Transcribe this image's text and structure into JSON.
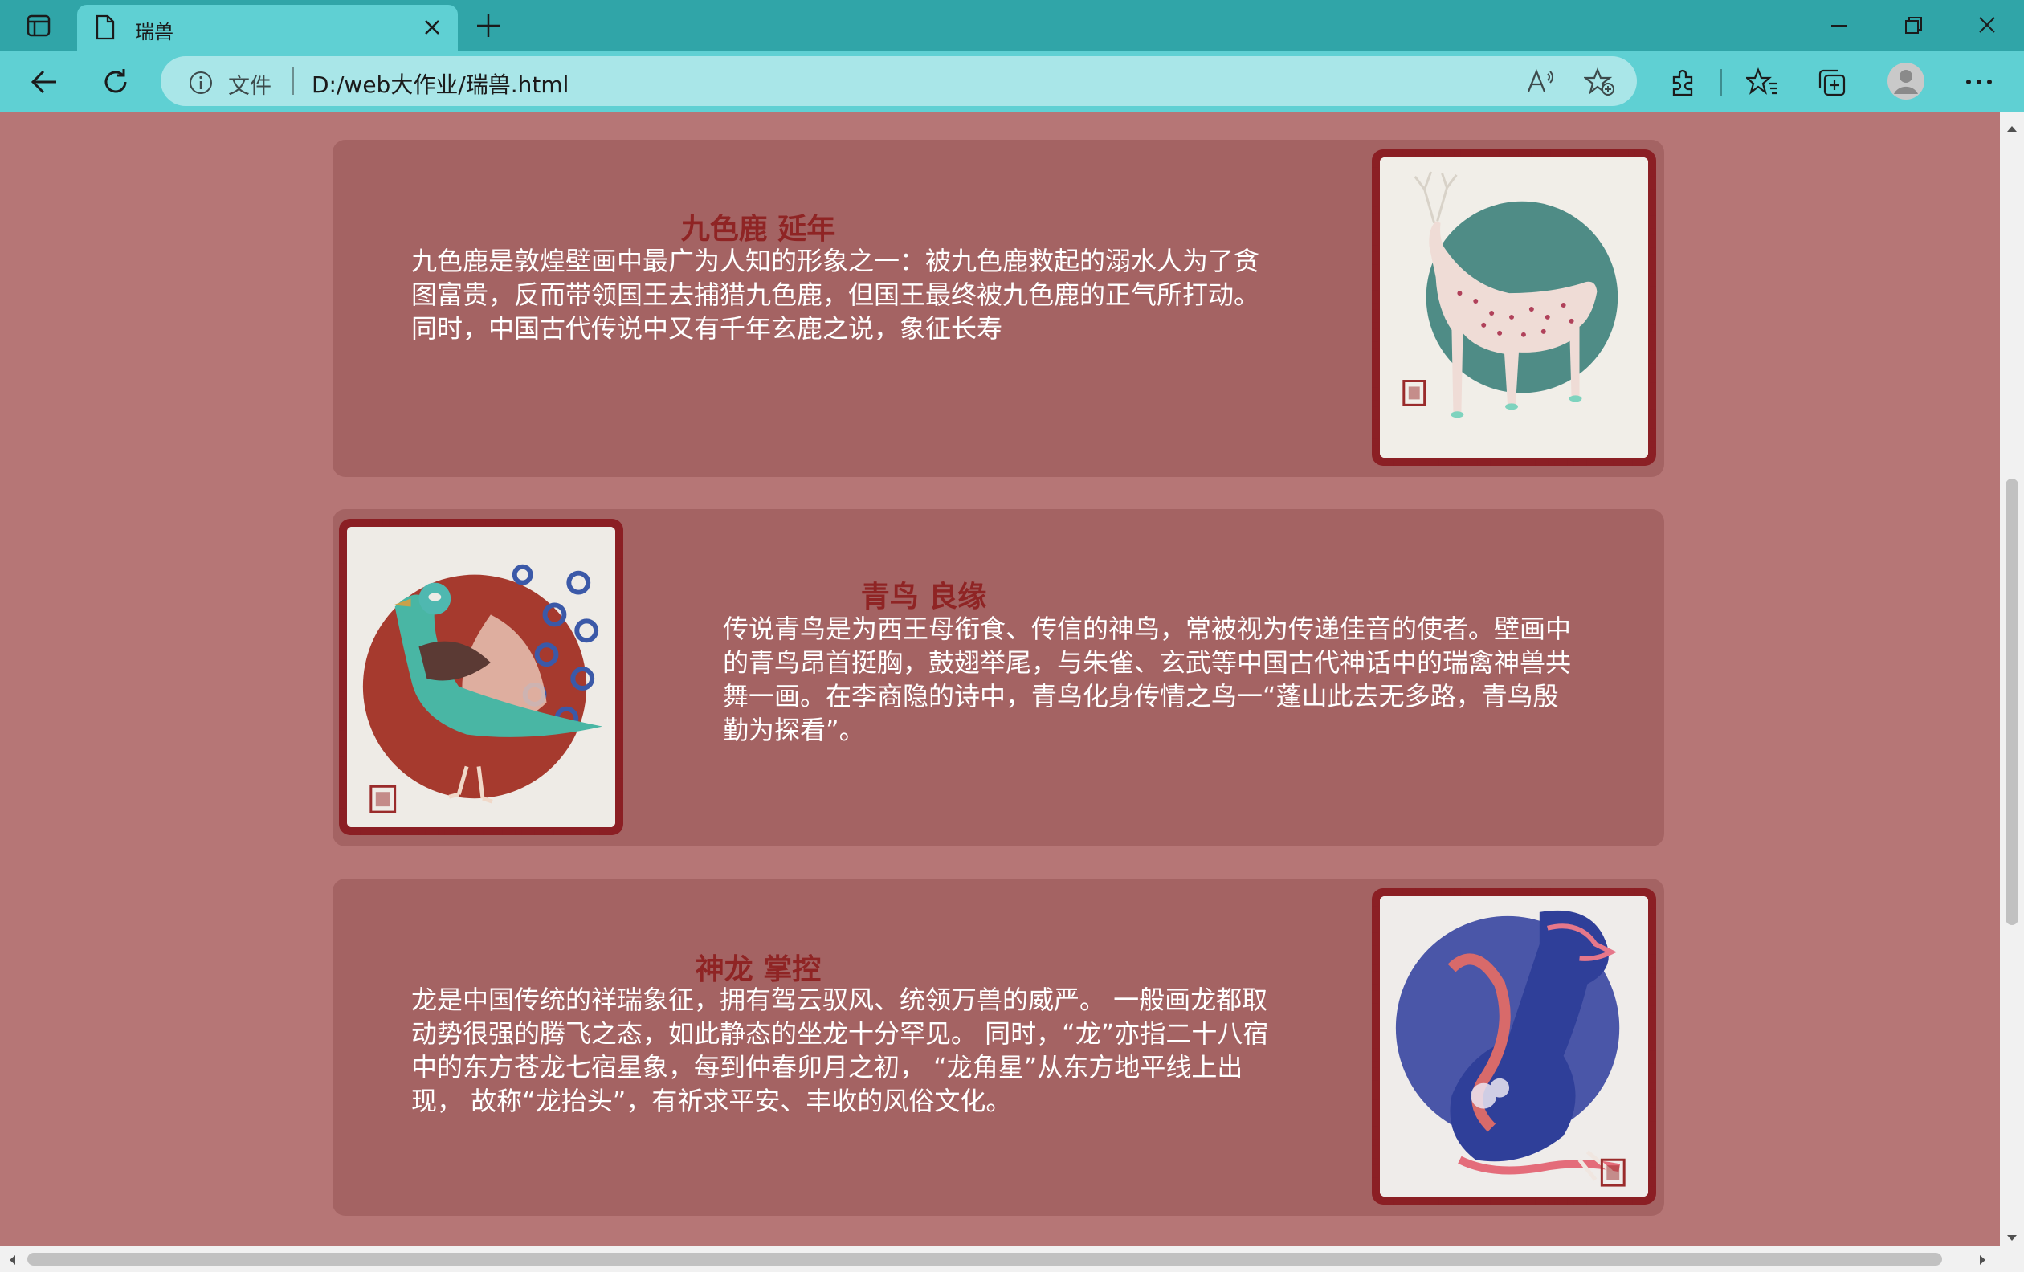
{
  "browser": {
    "tab_title": "瑞兽",
    "address_scheme_label": "文件",
    "url": "D:/web大作业/瑞兽.html"
  },
  "cards": [
    {
      "title": "九色鹿 延年",
      "text": "九色鹿是敦煌壁画中最广为人知的形象之一：被九色鹿救起的溺水人为了贪图富贵，反而带领国王去捕猎九色鹿，但国王最终被九色鹿的正气所打动。同时，中国古代传说中又有千年玄鹿之说，象征长寿",
      "image": "nine-color-deer-illustration"
    },
    {
      "title": "青鸟 良缘",
      "text": "传说青鸟是为西王母衔食、传信的神鸟，常被视为传递佳音的使者。壁画中的青鸟昂首挺胸，鼓翅举尾，与朱雀、玄武等中国古代神话中的瑞禽神兽共舞一画。在李商隐的诗中，青鸟化身传情之鸟一“蓬山此去无多路，青鸟殷勤为探看”。",
      "image": "blue-bird-illustration"
    },
    {
      "title": "神龙 掌控",
      "text": "龙是中国传统的祥瑞象征，拥有驾云驭风、统领万兽的威严。 一般画龙都取动势很强的腾飞之态，如此静态的坐龙十分罕见。 同时，“龙”亦指二十八宿中的东方苍龙七宿星象，每到仲春卯月之初，  “龙角星”从东方地平线上出现，  故称“龙抬头”，有祈求平安、丰收的风俗文化。",
      "image": "dragon-illustration"
    }
  ],
  "colors": {
    "page_bg": "#b67676",
    "card_bg": "#a46363",
    "title": "#8f2424",
    "frame": "#8b1f24",
    "tabbar": "#30a5a8",
    "toolbar": "#5fd0d3"
  }
}
